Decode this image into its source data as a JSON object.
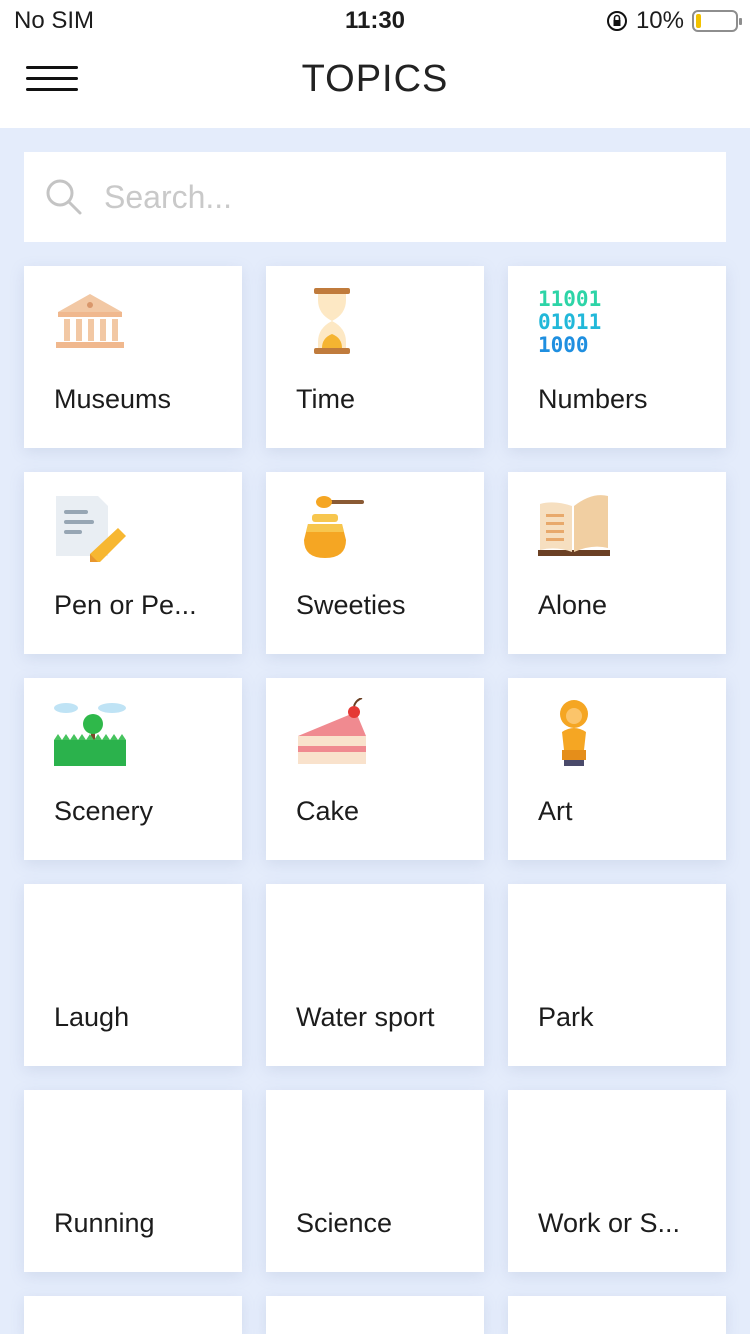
{
  "status_bar": {
    "carrier": "No SIM",
    "time": "11:30",
    "battery": "10%"
  },
  "header": {
    "title": "TOPICS"
  },
  "search": {
    "placeholder": "Search..."
  },
  "topics": [
    {
      "label": "Museums",
      "icon": "museum-icon"
    },
    {
      "label": "Time",
      "icon": "hourglass-icon"
    },
    {
      "label": "Numbers",
      "icon": "binary-numbers-icon"
    },
    {
      "label": "Pen or Pe...",
      "icon": "document-pencil-icon"
    },
    {
      "label": "Sweeties",
      "icon": "honey-jar-icon"
    },
    {
      "label": "Alone",
      "icon": "open-book-icon"
    },
    {
      "label": "Scenery",
      "icon": "landscape-icon"
    },
    {
      "label": "Cake",
      "icon": "cake-slice-icon"
    },
    {
      "label": "Art",
      "icon": "bust-statue-icon"
    },
    {
      "label": "Laugh",
      "icon": ""
    },
    {
      "label": "Water sport",
      "icon": ""
    },
    {
      "label": "Park",
      "icon": ""
    },
    {
      "label": "Running",
      "icon": ""
    },
    {
      "label": "Science",
      "icon": ""
    },
    {
      "label": "Work or S...",
      "icon": ""
    }
  ],
  "colors": {
    "background": "#e4ecfb",
    "card": "#ffffff",
    "battery_fill": "#f2c200"
  }
}
